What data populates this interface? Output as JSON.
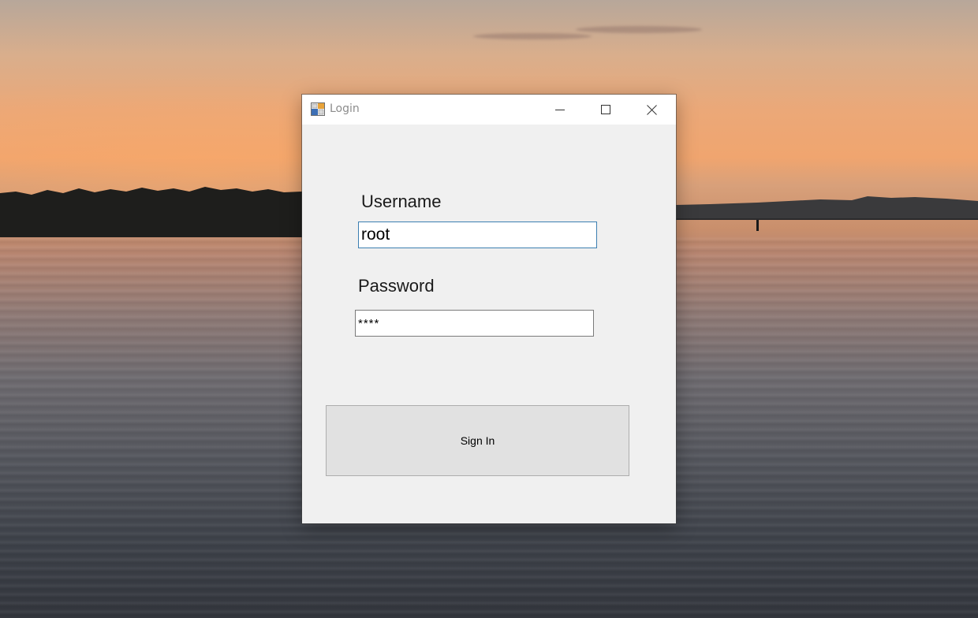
{
  "window": {
    "title": "Login",
    "icon": "app-form-icon",
    "controls": {
      "minimize_icon": "minimize-icon",
      "maximize_icon": "maximize-icon",
      "close_icon": "close-icon"
    }
  },
  "form": {
    "username_label": "Username",
    "username_value": "root",
    "password_label": "Password",
    "password_value": "****",
    "signin_label": "Sign In"
  },
  "colors": {
    "window_bg": "#f0f0f0",
    "titlebar_bg": "#ffffff",
    "focused_border": "#3c7fb1",
    "button_bg": "#e1e1e1"
  }
}
